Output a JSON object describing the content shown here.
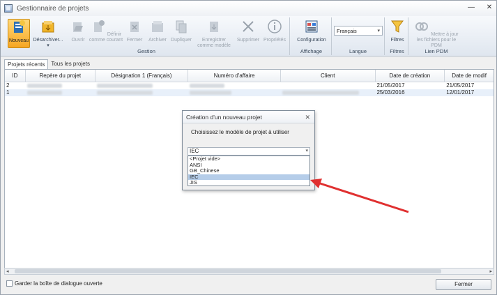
{
  "window": {
    "title": "Gestionnaire de projets"
  },
  "ribbon": {
    "gestion": {
      "label": "Gestion",
      "buttons": [
        {
          "label": "Nouveau",
          "icon": "new-project-icon",
          "active": true
        },
        {
          "label": "Désarchiver...",
          "icon": "unarchive-icon",
          "active": false
        },
        {
          "label": "Ouvrir",
          "icon": "open-icon",
          "active": false
        },
        {
          "label": "Définir comme courant",
          "icon": "set-current-icon",
          "active": false
        },
        {
          "label": "Fermer",
          "icon": "close-project-icon",
          "active": false
        },
        {
          "label": "Archiver",
          "icon": "archive-icon",
          "active": false
        },
        {
          "label": "Dupliquer",
          "icon": "duplicate-icon",
          "active": false
        },
        {
          "label": "Enregistrer comme modèle",
          "icon": "save-template-icon",
          "active": false
        },
        {
          "label": "Supprimer",
          "icon": "delete-icon",
          "active": false
        },
        {
          "label": "Propriétés",
          "icon": "info-icon",
          "active": false
        }
      ]
    },
    "affichage": {
      "label": "Affichage",
      "button": "Configuration"
    },
    "langue": {
      "label": "Langue",
      "value": "Français"
    },
    "filtres": {
      "label": "Filtres",
      "button": "Filtres"
    },
    "pdm": {
      "label": "Lien PDM",
      "button": "Mettre à jour les fichiers pour le PDM"
    }
  },
  "tabs": [
    "Projets récents",
    "Tous les projets"
  ],
  "table": {
    "columns": [
      "ID",
      "Repère du projet",
      "Désignation 1 (Français)",
      "Numéro d'affaire",
      "Client",
      "Date de création",
      "Date de modif"
    ],
    "rows": [
      {
        "id": "2",
        "created": "21/05/2017",
        "modified": "21/05/2017"
      },
      {
        "id": "1",
        "created": "25/03/2016",
        "modified": "12/01/2017"
      }
    ]
  },
  "bottom": {
    "checkbox_label": "Garder la boîte de dialogue ouverte",
    "close_label": "Fermer"
  },
  "dialog": {
    "title": "Création d'un nouveau projet",
    "prompt": "Choisissez le modèle de projet à utiliser",
    "selected": "IEC",
    "options": [
      "<Projet vide>",
      "ANSI",
      "GB_Chinese",
      "IEC",
      "JIS"
    ],
    "highlighted_index": 3
  },
  "annotation": {
    "arrow_color": "#e03030"
  }
}
